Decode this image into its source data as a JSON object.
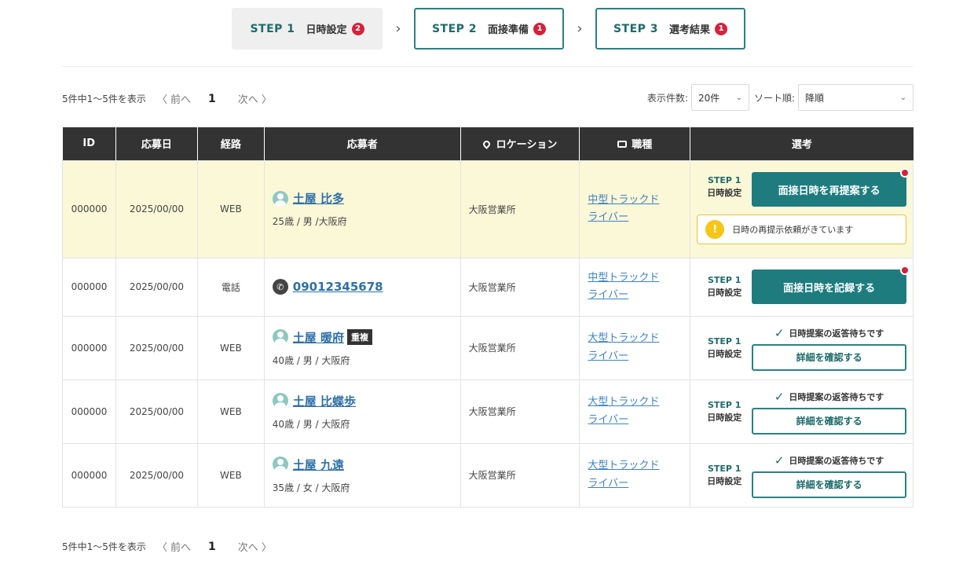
{
  "steps": [
    {
      "num": "STEP 1",
      "name": "日時設定",
      "badge": "2"
    },
    {
      "num": "STEP 2",
      "name": "面接準備",
      "badge": "1"
    },
    {
      "num": "STEP 3",
      "name": "選考結果",
      "badge": "1"
    }
  ],
  "pager": {
    "summary": "5件中1～5件を表示",
    "prev": "〈 前へ",
    "page": "1",
    "next": "次へ 〉"
  },
  "controls": {
    "count_label": "表示件数:",
    "count_value": "20件",
    "sort_label": "ソート順:",
    "sort_value": "降順"
  },
  "table": {
    "headers": {
      "id": "ID",
      "date": "応募日",
      "route": "経路",
      "applicant": "応募者",
      "location": "ロケーション",
      "job": "職種",
      "selection": "選考"
    },
    "rows": [
      {
        "id": "000000",
        "date": "2025/00/00",
        "route": "WEB",
        "name": "土屋 比多",
        "detail": "25歳 / 男 /大阪府",
        "location": "大阪営業所",
        "job1": "中型トラックド",
        "job2": "ライバー",
        "step": "STEP 1",
        "step_name": "日時設定",
        "button": "面接日時を再提案する",
        "warning": "日時の再提示依頼がきています"
      },
      {
        "id": "000000",
        "date": "2025/00/00",
        "route": "電話",
        "phone": "09012345678",
        "location": "大阪営業所",
        "job1": "中型トラックド",
        "job2": "ライバー",
        "step": "STEP 1",
        "step_name": "日時設定",
        "button": "面接日時を記録する"
      },
      {
        "id": "000000",
        "date": "2025/00/00",
        "route": "WEB",
        "name": "土屋 暖府",
        "tag": "重複",
        "detail": "40歳 / 男 / 大阪府",
        "location": "大阪営業所",
        "job1": "大型トラックド",
        "job2": "ライバー",
        "step": "STEP 1",
        "step_name": "日時設定",
        "note": "日時提案の返答待ちです",
        "button": "詳細を確認する"
      },
      {
        "id": "000000",
        "date": "2025/00/00",
        "route": "WEB",
        "name": "土屋 比蝶歩",
        "detail": "40歳 / 男 / 大阪府",
        "location": "大阪営業所",
        "job1": "大型トラックド",
        "job2": "ライバー",
        "step": "STEP 1",
        "step_name": "日時設定",
        "note": "日時提案の返答待ちです",
        "button": "詳細を確認する"
      },
      {
        "id": "000000",
        "date": "2025/00/00",
        "route": "WEB",
        "name": "土屋 九遠",
        "detail": "35歳 / 女 / 大阪府",
        "location": "大阪営業所",
        "job1": "大型トラックド",
        "job2": "ライバー",
        "step": "STEP 1",
        "step_name": "日時設定",
        "note": "日時提案の返答待ちです",
        "button": "詳細を確認する"
      }
    ]
  }
}
